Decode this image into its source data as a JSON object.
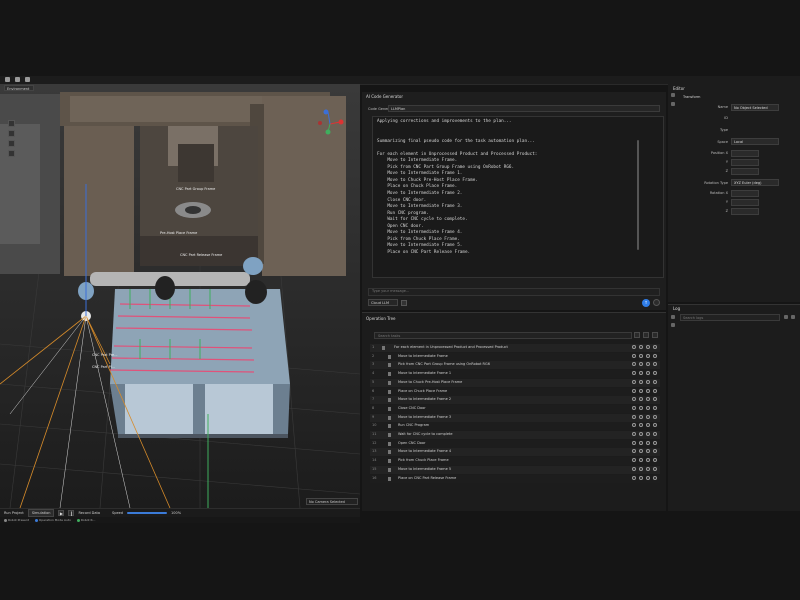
{
  "viewport": {
    "environment_label": "Environment",
    "camera_select": "No Camera Selected",
    "labels": [
      "CNC Part Group Frame",
      "CNC Part Release Frame",
      "Pre-Host Place Frame",
      "CNC Part Pre...",
      "CNC Part Pl..."
    ]
  },
  "bottombar": {
    "run_project_label": "Run Project",
    "mode": "Simulation",
    "record_label": "Record Data",
    "speed_label": "Speed",
    "speed_value": "100%",
    "status": [
      "Robot Present",
      "Operation Mode Auto",
      "Robot R..."
    ]
  },
  "ai_panel": {
    "title": "AI Code Generator",
    "generator_label": "Code Generator",
    "generator_value": "LLMPlan",
    "code_text": "Applying corrections and improvements to the plan...\n\n\nSummarizing final pseudo code for the task automation plan...\n\nFor each element in Unprocessed Product and Processed Product:\n    Move to Intermediate Frame.\n    Pick from CNC Part Group Frame using OnRobot RG6.\n    Move to Intermediate Frame 1.\n    Move to Chuck Pre-Host Place Frame.\n    Place on Chuck Place Frame.\n    Move to Intermediate Frame 2.\n    Close CNC door.\n    Move to Intermediate Frame 3.\n    Run CNC program.\n    Wait for CNC cycle to complete.\n    Open CNC door.\n    Move to Intermediate Frame 4.\n    Pick from Chuck Place Frame.\n    Move to Intermediate Frame 5.\n    Place on CNC Part Release Frame.",
    "prompt_placeholder": "Type your message...",
    "model_value": "Cloud LLM"
  },
  "op_panel": {
    "title": "Operation Tree",
    "search_placeholder": "Search tasks",
    "rows": [
      {
        "num": "1",
        "label": "For each element in Unprocessed Product and Processed Product"
      },
      {
        "num": "2",
        "label": "Move to Intermediate Frame"
      },
      {
        "num": "3",
        "label": "Pick from CNC Part Group Frame using OnRobot RG6"
      },
      {
        "num": "4",
        "label": "Move to Intermediate Frame 1"
      },
      {
        "num": "5",
        "label": "Move to Chuck Pre-Host Place Frame"
      },
      {
        "num": "6",
        "label": "Place on Chuck Place Frame"
      },
      {
        "num": "7",
        "label": "Move to Intermediate Frame 2"
      },
      {
        "num": "8",
        "label": "Close CNC Door"
      },
      {
        "num": "9",
        "label": "Move to Intermediate Frame 3"
      },
      {
        "num": "10",
        "label": "Run CNC Program"
      },
      {
        "num": "11",
        "label": "Wait for CNC cycle to complete"
      },
      {
        "num": "12",
        "label": "Open CNC Door"
      },
      {
        "num": "13",
        "label": "Move to Intermediate Frame 4"
      },
      {
        "num": "14",
        "label": "Pick from Chuck Place Frame"
      },
      {
        "num": "15",
        "label": "Move to Intermediate Frame 5"
      },
      {
        "num": "16",
        "label": "Place on CNC Part Release Frame"
      }
    ]
  },
  "editor": {
    "title": "Editor",
    "section": "Transform",
    "name_label": "Name",
    "name_value": "No Object Selected",
    "id_label": "ID",
    "type_label": "Type",
    "space_label": "Space",
    "space_value": "Local",
    "position_label": "Position X",
    "y_label": "Y",
    "z_label": "Z",
    "rotation_type_label": "Rotation Type",
    "rotation_type_value": "XYZ Euler (deg)",
    "rotation_label": "Rotation X"
  },
  "log": {
    "title": "Log",
    "search_placeholder": "Search logs"
  },
  "colors": {
    "accent": "#2f7de8",
    "panel": "#1c1c1c",
    "viewport": "#242424"
  }
}
